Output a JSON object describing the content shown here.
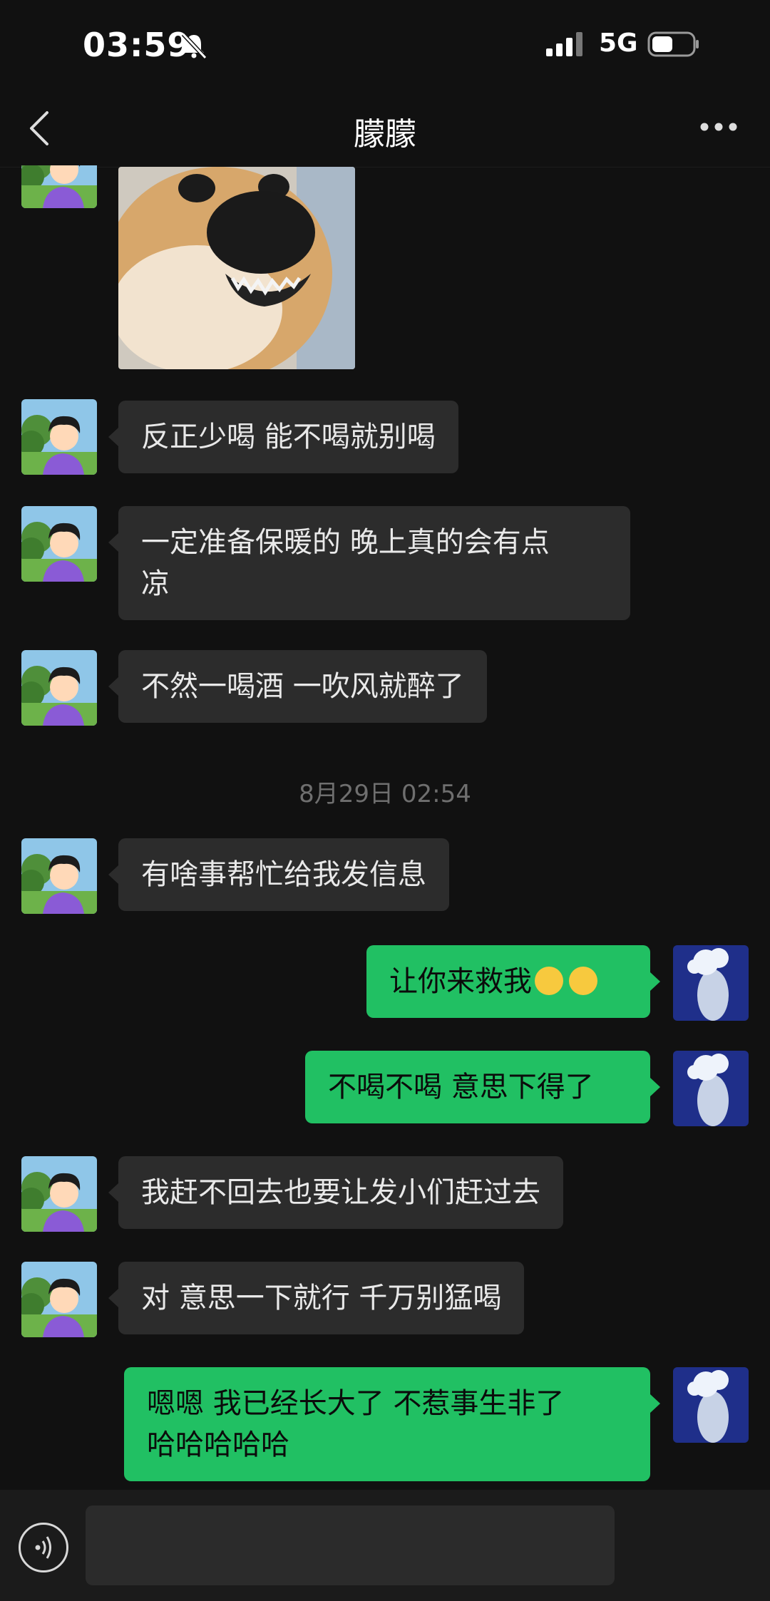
{
  "status_bar": {
    "time": "03:59",
    "network": "5G"
  },
  "header": {
    "title": "朦朦"
  },
  "messages": [
    {
      "side": "left",
      "type": "image",
      "description": "shiba-sticker"
    },
    {
      "side": "left",
      "text": "反正少喝 能不喝就别喝"
    },
    {
      "side": "left",
      "text_line1": "一定准备保暖的 晚上真的会有点",
      "text_line2": "凉"
    },
    {
      "side": "left",
      "text": "不然一喝酒 一吹风就醉了"
    },
    {
      "side": "left",
      "text": "有啥事帮忙给我发信息"
    },
    {
      "side": "right",
      "text": "让你来救我"
    },
    {
      "side": "right",
      "text": "不喝不喝 意思下得了"
    },
    {
      "side": "left",
      "text": "我赶不回去也要让发小们赶过去"
    },
    {
      "side": "left",
      "text": "对 意思一下就行 千万别猛喝"
    },
    {
      "side": "right",
      "text_line1": "嗯嗯 我已经长大了 不惹事生非了",
      "text_line2": "哈哈哈哈哈"
    }
  ],
  "timestamp": "8月29日 02:54",
  "colors": {
    "background": "#111111",
    "bubble_left": "#2c2c2c",
    "bubble_right": "#21c063"
  }
}
